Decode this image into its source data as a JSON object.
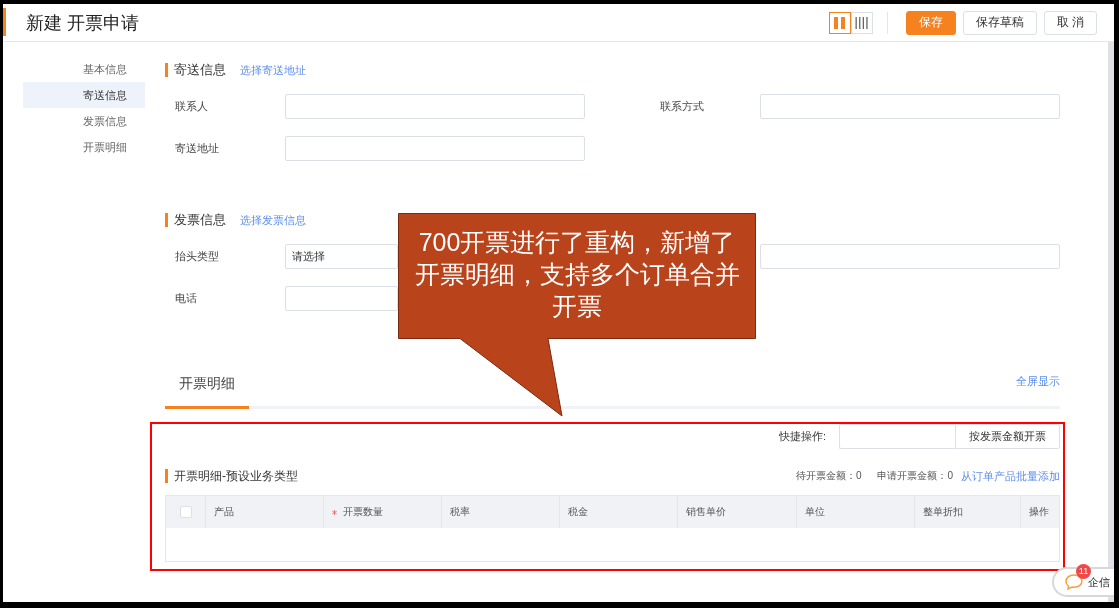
{
  "page": {
    "title": "新建 开票申请"
  },
  "toolbar": {
    "view_modes": [
      {
        "kind": "two-column",
        "selected": true
      },
      {
        "kind": "four-column",
        "selected": false
      }
    ],
    "buttons": [
      {
        "label": "保存",
        "kind": "primary"
      },
      {
        "label": "保存草稿",
        "kind": "default"
      },
      {
        "label": "取 消",
        "kind": "default"
      }
    ]
  },
  "nav": {
    "items": [
      {
        "label": "基本信息",
        "selected": false
      },
      {
        "label": "寄送信息",
        "selected": true
      },
      {
        "label": "发票信息",
        "selected": false
      },
      {
        "label": "开票明细",
        "selected": false
      }
    ]
  },
  "sections": [
    {
      "title": "寄送信息",
      "link": "选择寄送地址",
      "fields": [
        {
          "label": "联系人",
          "kind": "input"
        },
        {
          "label": "联系方式",
          "kind": "input"
        },
        {
          "label": "寄送地址",
          "kind": "input"
        }
      ]
    },
    {
      "title": "发票信息",
      "link": "选择发票信息",
      "fields": [
        {
          "label": "抬头类型",
          "kind": "select",
          "value": "请选择"
        },
        {
          "kind": "input"
        },
        {
          "label": "电话",
          "kind": "input"
        }
      ]
    }
  ],
  "detail": {
    "tabs": [
      {
        "label": "开票明细",
        "selected": true
      }
    ],
    "fullscreen_link": "全屏显示",
    "quick_action": {
      "label": "快捷操作:",
      "button": "按发票金额开票"
    },
    "subtitle": "开票明细-预设业务类型",
    "summary": [
      "待开票金额：0",
      "申请开票金额：0"
    ],
    "add_link": "从订单产品批量添加",
    "table": {
      "select_all_checked": false,
      "columns": [
        {
          "label": "产品",
          "required": false
        },
        {
          "label": "开票数量",
          "required": true
        },
        {
          "label": "税率",
          "required": false
        },
        {
          "label": "税金",
          "required": false
        },
        {
          "label": "销售单价",
          "required": false
        },
        {
          "label": "单位",
          "required": false
        },
        {
          "label": "整单折扣",
          "required": false
        },
        {
          "label": "操作",
          "required": false
        }
      ]
    }
  },
  "callout": {
    "text": "700开票进行了重构，新增了开票明细，支持多个订单合并开票"
  },
  "chat": {
    "label": "企信",
    "badge": "11"
  }
}
